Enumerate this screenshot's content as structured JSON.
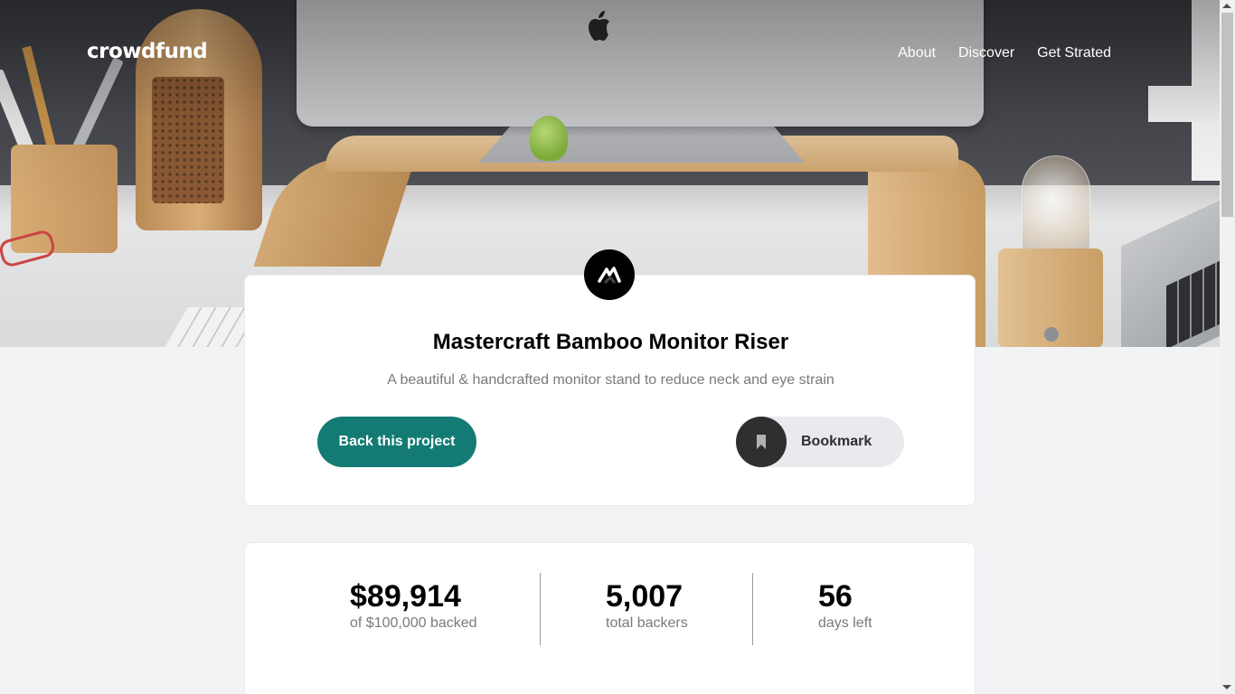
{
  "brand": {
    "logo_text": "crowdfund"
  },
  "nav": {
    "items": [
      {
        "label": "About"
      },
      {
        "label": "Discover"
      },
      {
        "label": "Get Strated"
      }
    ]
  },
  "project": {
    "title": "Mastercraft Bamboo Monitor Riser",
    "subtitle": "A beautiful & handcrafted monitor stand to reduce neck and eye strain",
    "back_button_label": "Back this project",
    "bookmark_label": "Bookmark",
    "logo_icon": "mastercraft-logo-icon",
    "bookmark_icon": "bookmark-icon"
  },
  "stats": [
    {
      "value": "$89,914",
      "label": "of $100,000 backed"
    },
    {
      "value": "5,007",
      "label": "total backers"
    },
    {
      "value": "56",
      "label": "days left"
    }
  ],
  "colors": {
    "primary": "#147b74",
    "dark": "#2f2f2f",
    "page_bg": "#f2f3f5"
  }
}
